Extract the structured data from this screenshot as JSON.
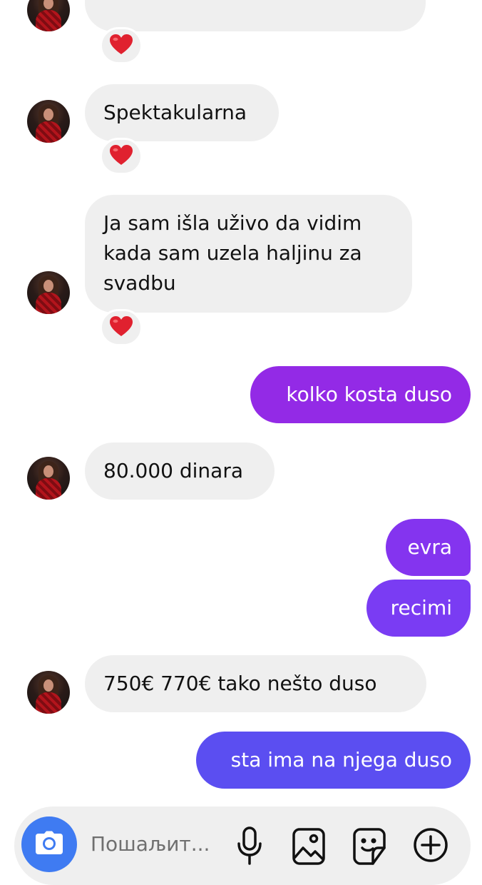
{
  "conversation": {
    "reaction_emoji": "❤️",
    "messages": [
      {
        "id": "msg-1",
        "side": "incoming",
        "text": "Spektakularna",
        "reaction": "❤️"
      },
      {
        "id": "msg-2",
        "side": "incoming",
        "lines": [
          "Ja sam išla uživo da vidim",
          "kada sam uzela haljinu za",
          "svadbu"
        ],
        "reaction": "❤️"
      },
      {
        "id": "msg-3",
        "side": "outgoing",
        "text": "kolko kosta duso"
      },
      {
        "id": "msg-4",
        "side": "incoming",
        "text": "80.000 dinara"
      },
      {
        "id": "msg-5",
        "side": "outgoing",
        "text": "evra"
      },
      {
        "id": "msg-6",
        "side": "outgoing",
        "text": "recimi"
      },
      {
        "id": "msg-7",
        "side": "incoming",
        "text": "750€ 770€ tako nešto duso"
      },
      {
        "id": "msg-8",
        "side": "outgoing",
        "text": "sta ima na njega duso"
      }
    ]
  },
  "composer": {
    "placeholder": "Пошаљит...",
    "icons": [
      "camera-icon",
      "microphone-icon",
      "gallery-icon",
      "sticker-icon",
      "add-icon"
    ]
  },
  "colors": {
    "incoming_bubble": "#efefef",
    "outgoing_gradient_top": "#9328e6",
    "outgoing_gradient_mid": "#7a3cf4",
    "outgoing_gradient_bottom": "#5a4ef1",
    "camera_button": "#3f7bf2",
    "heart": "#e0212f"
  }
}
